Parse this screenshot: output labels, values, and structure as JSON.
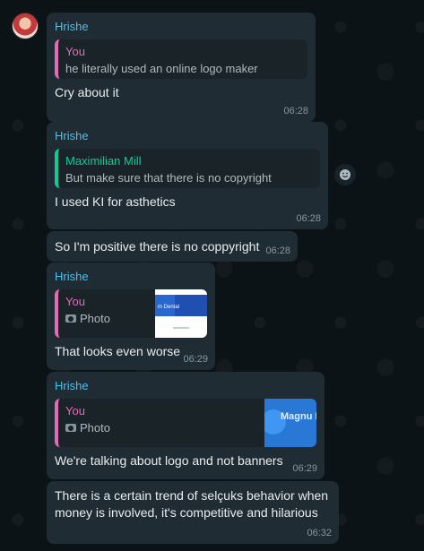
{
  "messages": [
    {
      "sender": "Hrishe",
      "quote": {
        "author": "You",
        "text": "he literally used an online logo maker"
      },
      "text": "Cry about it",
      "time": "06:28"
    },
    {
      "sender": "Hrishe",
      "quote": {
        "author": "Maximilian Mill",
        "text": "But make sure that there is no copyright"
      },
      "text": "I used KI for asthetics",
      "time": "06:28"
    },
    {
      "text": "So I'm positive there is no coppyright",
      "time": "06:28"
    },
    {
      "sender": "Hrishe",
      "quote": {
        "author": "You",
        "photo_label": "Photo",
        "thumb_text": "m Dental"
      },
      "text": "That looks even worse",
      "time": "06:29"
    },
    {
      "sender": "Hrishe",
      "quote": {
        "author": "You",
        "photo_label": "Photo",
        "thumb_text": "Magnu Dental"
      },
      "text": "We're talking about logo and not banners",
      "time": "06:29"
    },
    {
      "text": "There is a certain trend of selçuks behavior when money is involved, it's competitive and hilarious",
      "time": "06:32"
    }
  ],
  "colors": {
    "background": "#0c1317",
    "bubble": "#202c33",
    "sender": "#53bdeb",
    "quote_you": "#e26ab6",
    "quote_other": "#06cf9c",
    "meta": "#8696a0"
  },
  "icons": {
    "avatar": "contact-avatar",
    "reaction": "emoji-smile-icon",
    "photo": "camera-icon"
  }
}
